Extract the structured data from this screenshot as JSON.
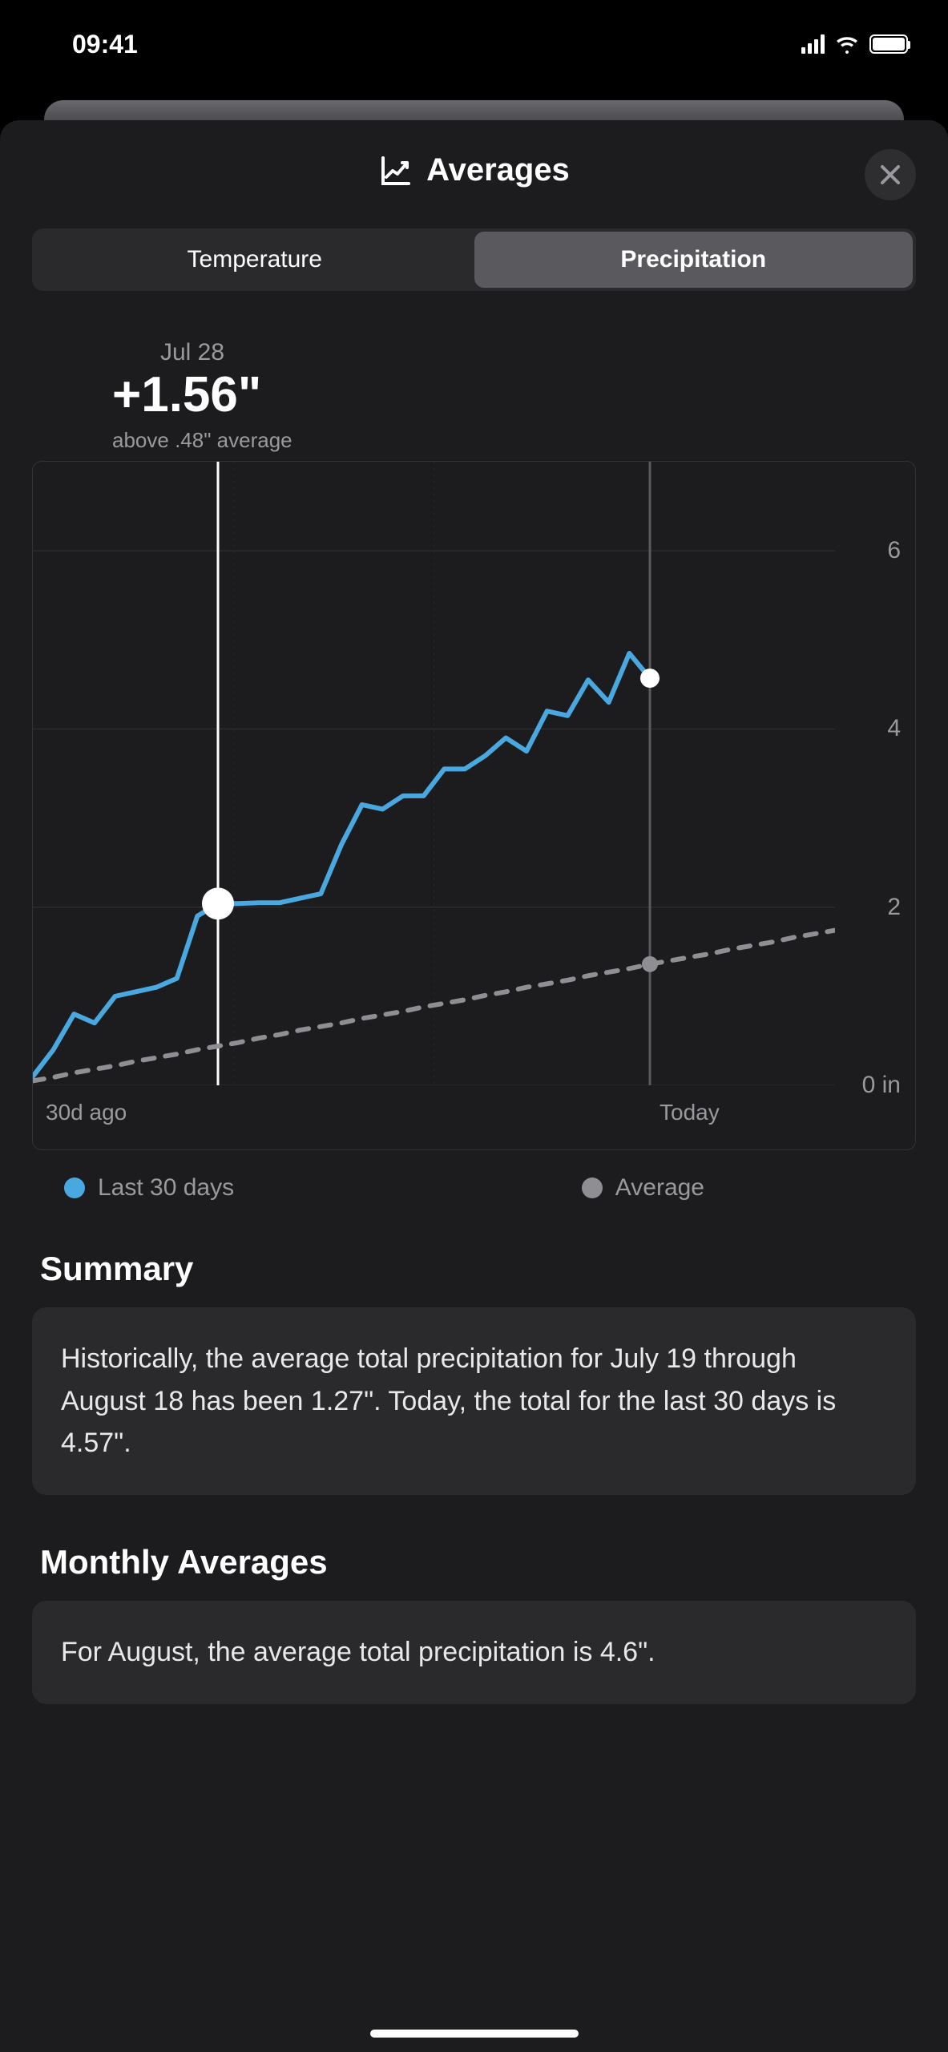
{
  "status": {
    "time": "09:41"
  },
  "header": {
    "title": "Averages"
  },
  "segmented": {
    "temperature": "Temperature",
    "precipitation": "Precipitation"
  },
  "callout": {
    "date": "Jul 28",
    "value": "+1.56\"",
    "sub": "above .48\" average"
  },
  "chart_data": {
    "type": "line",
    "xlabel": "",
    "ylabel": "",
    "ylim": [
      0,
      7
    ],
    "y_ticks": [
      0,
      2,
      4,
      6
    ],
    "y_unit": "in",
    "x_labels": {
      "start": "30d ago",
      "today": "Today"
    },
    "today_index": 30,
    "cursor_index": 9,
    "series": [
      {
        "name": "Last 30 days",
        "color": "#4aa8e0",
        "style": "solid",
        "values": [
          0.1,
          0.4,
          0.8,
          0.7,
          1.0,
          1.05,
          1.1,
          1.2,
          1.9,
          2.04,
          2.04,
          2.05,
          2.05,
          2.1,
          2.15,
          2.7,
          3.15,
          3.1,
          3.25,
          3.25,
          3.55,
          3.55,
          3.7,
          3.9,
          3.75,
          4.2,
          4.15,
          4.55,
          4.3,
          4.85,
          4.57
        ]
      },
      {
        "name": "Average",
        "color": "#8e8e93",
        "style": "dashed",
        "values": [
          0.05,
          0.09,
          0.14,
          0.18,
          0.22,
          0.27,
          0.31,
          0.35,
          0.4,
          0.44,
          0.48,
          0.53,
          0.57,
          0.62,
          0.66,
          0.7,
          0.75,
          0.79,
          0.83,
          0.88,
          0.92,
          0.96,
          1.01,
          1.05,
          1.1,
          1.14,
          1.18,
          1.23,
          1.27,
          1.31,
          1.36,
          1.4,
          1.44,
          1.48,
          1.53,
          1.57,
          1.61,
          1.66,
          1.7,
          1.74
        ]
      }
    ]
  },
  "legend": {
    "last30": "Last 30 days",
    "average": "Average"
  },
  "summary": {
    "title": "Summary",
    "text": "Historically, the average total precipitation for July 19 through August 18 has been 1.27\". Today, the total for the last 30 days is 4.57\"."
  },
  "monthly": {
    "title": "Monthly Averages",
    "text": "For August, the average total precipitation is 4.6\"."
  },
  "colors": {
    "accent": "#4aa8e0",
    "muted": "#8e8e93"
  }
}
